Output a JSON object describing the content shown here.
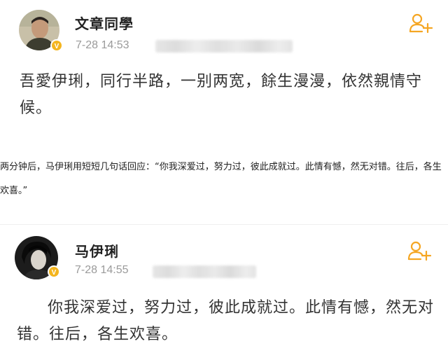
{
  "post1": {
    "username": "文章同學",
    "time": "7-28 14:53",
    "text": "吾愛伊琍，同行半路，一别两宽，餘生漫漫，依然親情守候。",
    "icons": {
      "follow": "add-user-icon",
      "verified": "verified-badge-icon"
    }
  },
  "article": {
    "text": "两分钟后，马伊琍用短短几句话回应：“你我深爱过，努力过，彼此成就过。此情有憾，然无对错。往后，各生欢喜。”"
  },
  "post2": {
    "username": "马伊琍",
    "time": "7-28 14:55",
    "text": "你我深爱过，努力过，彼此成就过。此情有憾，然无对错。往后，各生欢喜。",
    "icons": {
      "follow": "add-user-icon",
      "verified": "verified-badge-icon"
    }
  },
  "colors": {
    "accent": "#f5a623",
    "verified": "#f4b51e",
    "meta": "#9a9a9a",
    "text": "#333333"
  }
}
